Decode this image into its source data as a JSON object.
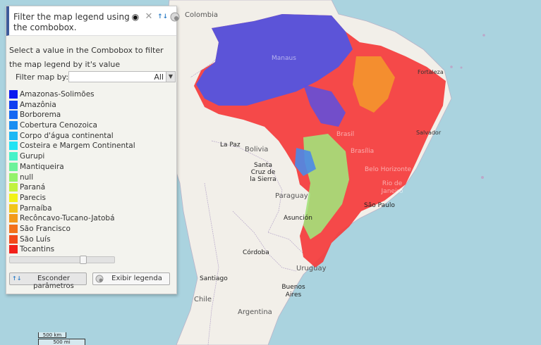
{
  "panel": {
    "title": "Filter the map legend using the combobox.",
    "description": "Select a value in the Combobox to filter the map legend by it's value",
    "filter": {
      "label": "Filter map by:",
      "value": "All"
    },
    "legend": [
      {
        "label": "Amazonas-Solimões",
        "color": "#0b18f0"
      },
      {
        "label": "Amazônia",
        "color": "#0f3df0"
      },
      {
        "label": "Borborema",
        "color": "#1567f2"
      },
      {
        "label": "Cobertura Cenozoica",
        "color": "#1a8ef2"
      },
      {
        "label": "Corpo d'água continental",
        "color": "#1cb8f4"
      },
      {
        "label": "Costeira e Margem Continental",
        "color": "#22e3f4"
      },
      {
        "label": "Gurupi",
        "color": "#46f2c8"
      },
      {
        "label": "Mantiqueira",
        "color": "#6df29a"
      },
      {
        "label": "null",
        "color": "#94f26a"
      },
      {
        "label": "Paraná",
        "color": "#c2f23e"
      },
      {
        "label": "Parecis",
        "color": "#f2f218"
      },
      {
        "label": "Parnaíba",
        "color": "#f2c51a"
      },
      {
        "label": "Recôncavo-Tucano-Jatobá",
        "color": "#f29a1a"
      },
      {
        "label": "São Francisco",
        "color": "#f2711a"
      },
      {
        "label": "São Luís",
        "color": "#f2481a"
      },
      {
        "label": "Tocantins",
        "color": "#f2201a"
      }
    ],
    "opacity": 0.72,
    "buttons": {
      "hide_params": "Esconder parâmetros",
      "show_legend": "Exibir legenda"
    },
    "icons": {
      "visibility": "eye-icon",
      "close": "close-icon",
      "params": "params-icon",
      "legend": "legend-icon"
    }
  },
  "map": {
    "labels": {
      "colombia": "Colombia",
      "manaus": "Manaus",
      "fortaleza": "Fortaleza",
      "salvador": "Salvador",
      "brasil": "Brasil",
      "brasilia": "Brasília",
      "belo_horizonte": "Belo Horizonte",
      "rio_de_janeiro": "Rio de Janeiro",
      "sao_paulo": "São Paulo",
      "la_paz": "La Paz",
      "bolivia": "Bolivia",
      "santa_cruz": "Santa Cruz de la Sierra",
      "paraguay": "Paraguay",
      "asuncion": "Asunción",
      "cordoba": "Córdoba",
      "uruguay": "Uruguay",
      "santiago": "Santiago",
      "buenos_aires": "Buenos Aires",
      "chile": "Chile",
      "argentina": "Argentina"
    },
    "colors": {
      "ocean": "#aad3df",
      "land": "#f2efe9",
      "overlay_primary": "#f53b3b"
    }
  },
  "scale": {
    "km": "500 km",
    "mi": "500 mi"
  }
}
